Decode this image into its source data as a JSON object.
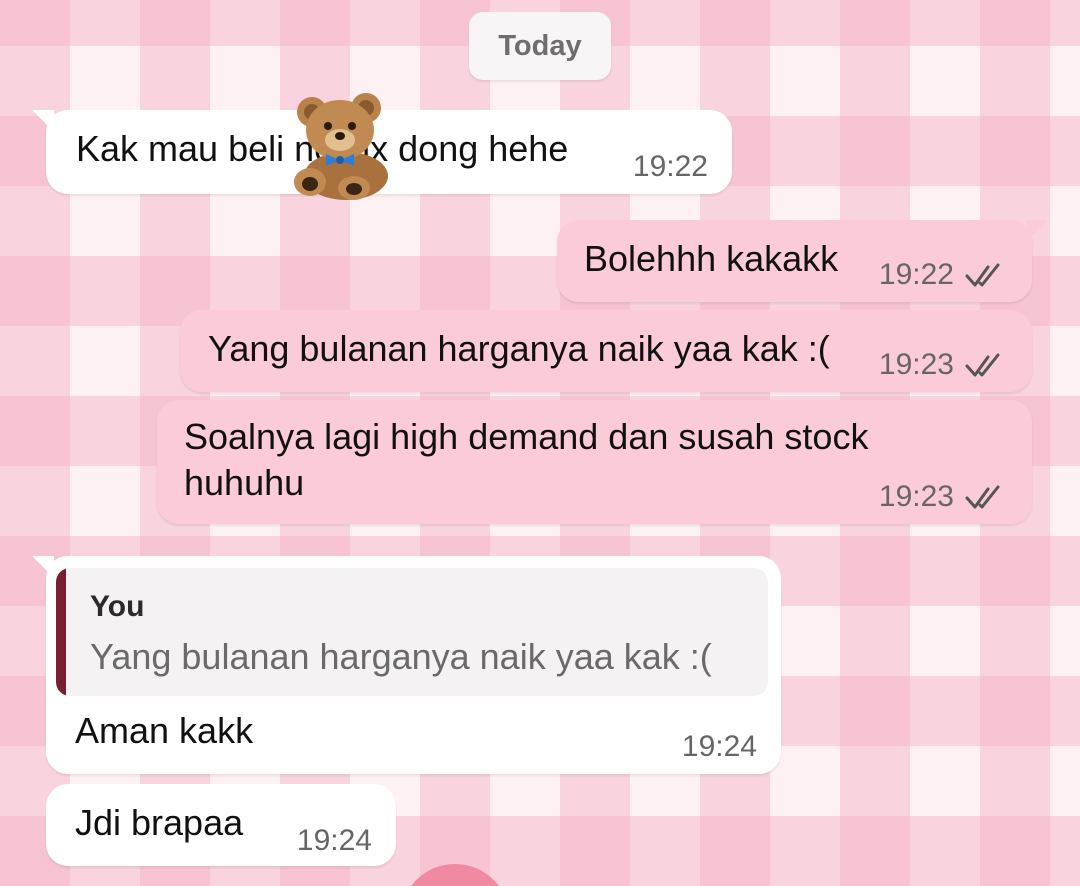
{
  "chat": {
    "date_label": "Today",
    "messages": [
      {
        "id": "m1",
        "direction": "incoming",
        "text": "Kak mau beli netflix dong hehe",
        "time": "19:22",
        "sticker": "teddy-bear"
      },
      {
        "id": "m2",
        "direction": "outgoing",
        "text": "Bolehhh kakakk",
        "time": "19:22",
        "status": "read-double-tick"
      },
      {
        "id": "m3",
        "direction": "outgoing",
        "text": "Yang bulanan harganya naik yaa kak :(",
        "time": "19:23",
        "status": "read-double-tick"
      },
      {
        "id": "m4",
        "direction": "outgoing",
        "text_line1": "Soalnya lagi high demand dan susah stock",
        "text_line2": "huhuhu",
        "time": "19:23",
        "status": "read-double-tick"
      },
      {
        "id": "m5",
        "direction": "incoming",
        "quote": {
          "author": "You",
          "text": "Yang bulanan harganya naik yaa kak :("
        },
        "text": "Aman kakk",
        "time": "19:24"
      },
      {
        "id": "m6",
        "direction": "incoming",
        "text": "Jdi brapaa",
        "time": "19:24"
      }
    ]
  },
  "colors": {
    "incoming_bubble": "#ffffff",
    "outgoing_bubble": "#fccbd8",
    "quote_bar": "#7a1f33",
    "tick": "#555555"
  }
}
